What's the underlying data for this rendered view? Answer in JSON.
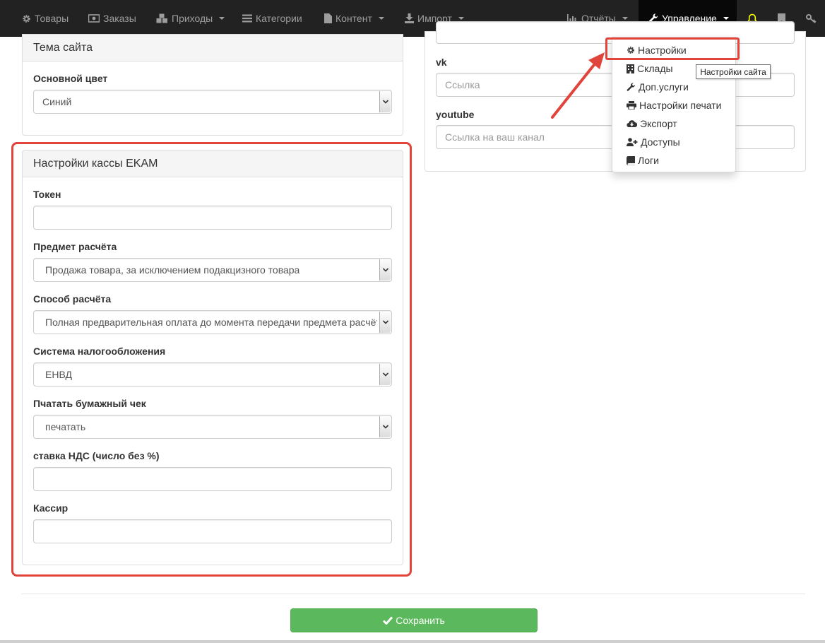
{
  "navbar": {
    "items": [
      {
        "label": "Товары",
        "icon": "gear-icon"
      },
      {
        "label": "Заказы",
        "icon": "money-icon"
      },
      {
        "label": "Приходы",
        "icon": "cubes-icon"
      },
      {
        "label": "Категории",
        "icon": "list-icon"
      },
      {
        "label": "Контент",
        "icon": "file-icon"
      },
      {
        "label": "Импорт",
        "icon": "download-icon"
      }
    ],
    "right_items": [
      {
        "label": "Отчёты",
        "icon": "bar-chart-icon"
      },
      {
        "label": "Управление",
        "icon": "wrench-icon"
      }
    ],
    "icons": [
      "bell-icon",
      "bookmark-icon",
      "key-icon"
    ],
    "accent_bell": "#ffff00",
    "bg": "#222222"
  },
  "theme_panel": {
    "title": "Тема сайта",
    "primary_color_label": "Основной цвет",
    "primary_color_value": "Синий"
  },
  "ekam_panel": {
    "title": "Настройки кассы EKAM",
    "fields": [
      {
        "label": "Токен",
        "value": ""
      },
      {
        "label": "Предмет расчёта",
        "value": "Продажа товара, за исключением подакцизного товара"
      },
      {
        "label": "Способ расчёта",
        "value": "Полная предварительная оплата до момента передачи предмета расчёта"
      },
      {
        "label": "Система налогообложения",
        "value": "ЕНВД"
      },
      {
        "label": "Пчатать бумажный чек",
        "value": "печатать"
      },
      {
        "label": "ставка НДС (число без %)",
        "value": ""
      },
      {
        "label": "Кассир",
        "value": ""
      }
    ]
  },
  "social_panel": {
    "vk_label": "vk",
    "vk_placeholder": "Ссылка",
    "youtube_label": "youtube",
    "youtube_placeholder": "Ссылка на ваш канал"
  },
  "dropdown": {
    "items": [
      {
        "label": "Настройки",
        "icon": "gear-icon"
      },
      {
        "label": "Склады",
        "icon": "building-icon"
      },
      {
        "label": "Доп.услуги",
        "icon": "wrench-icon"
      },
      {
        "label": "Настройки печати",
        "icon": "print-icon"
      },
      {
        "label": "Экспорт",
        "icon": "cloud-download-icon"
      },
      {
        "label": "Доступы",
        "icon": "user-plus-icon"
      },
      {
        "label": "Логи",
        "icon": "book-icon"
      }
    ],
    "tooltip": "Настройки сайта"
  },
  "save_button": {
    "label": "Сохранить",
    "icon": "check-icon"
  },
  "colors": {
    "highlight": "#e0443a",
    "success": "#5cb85c"
  }
}
